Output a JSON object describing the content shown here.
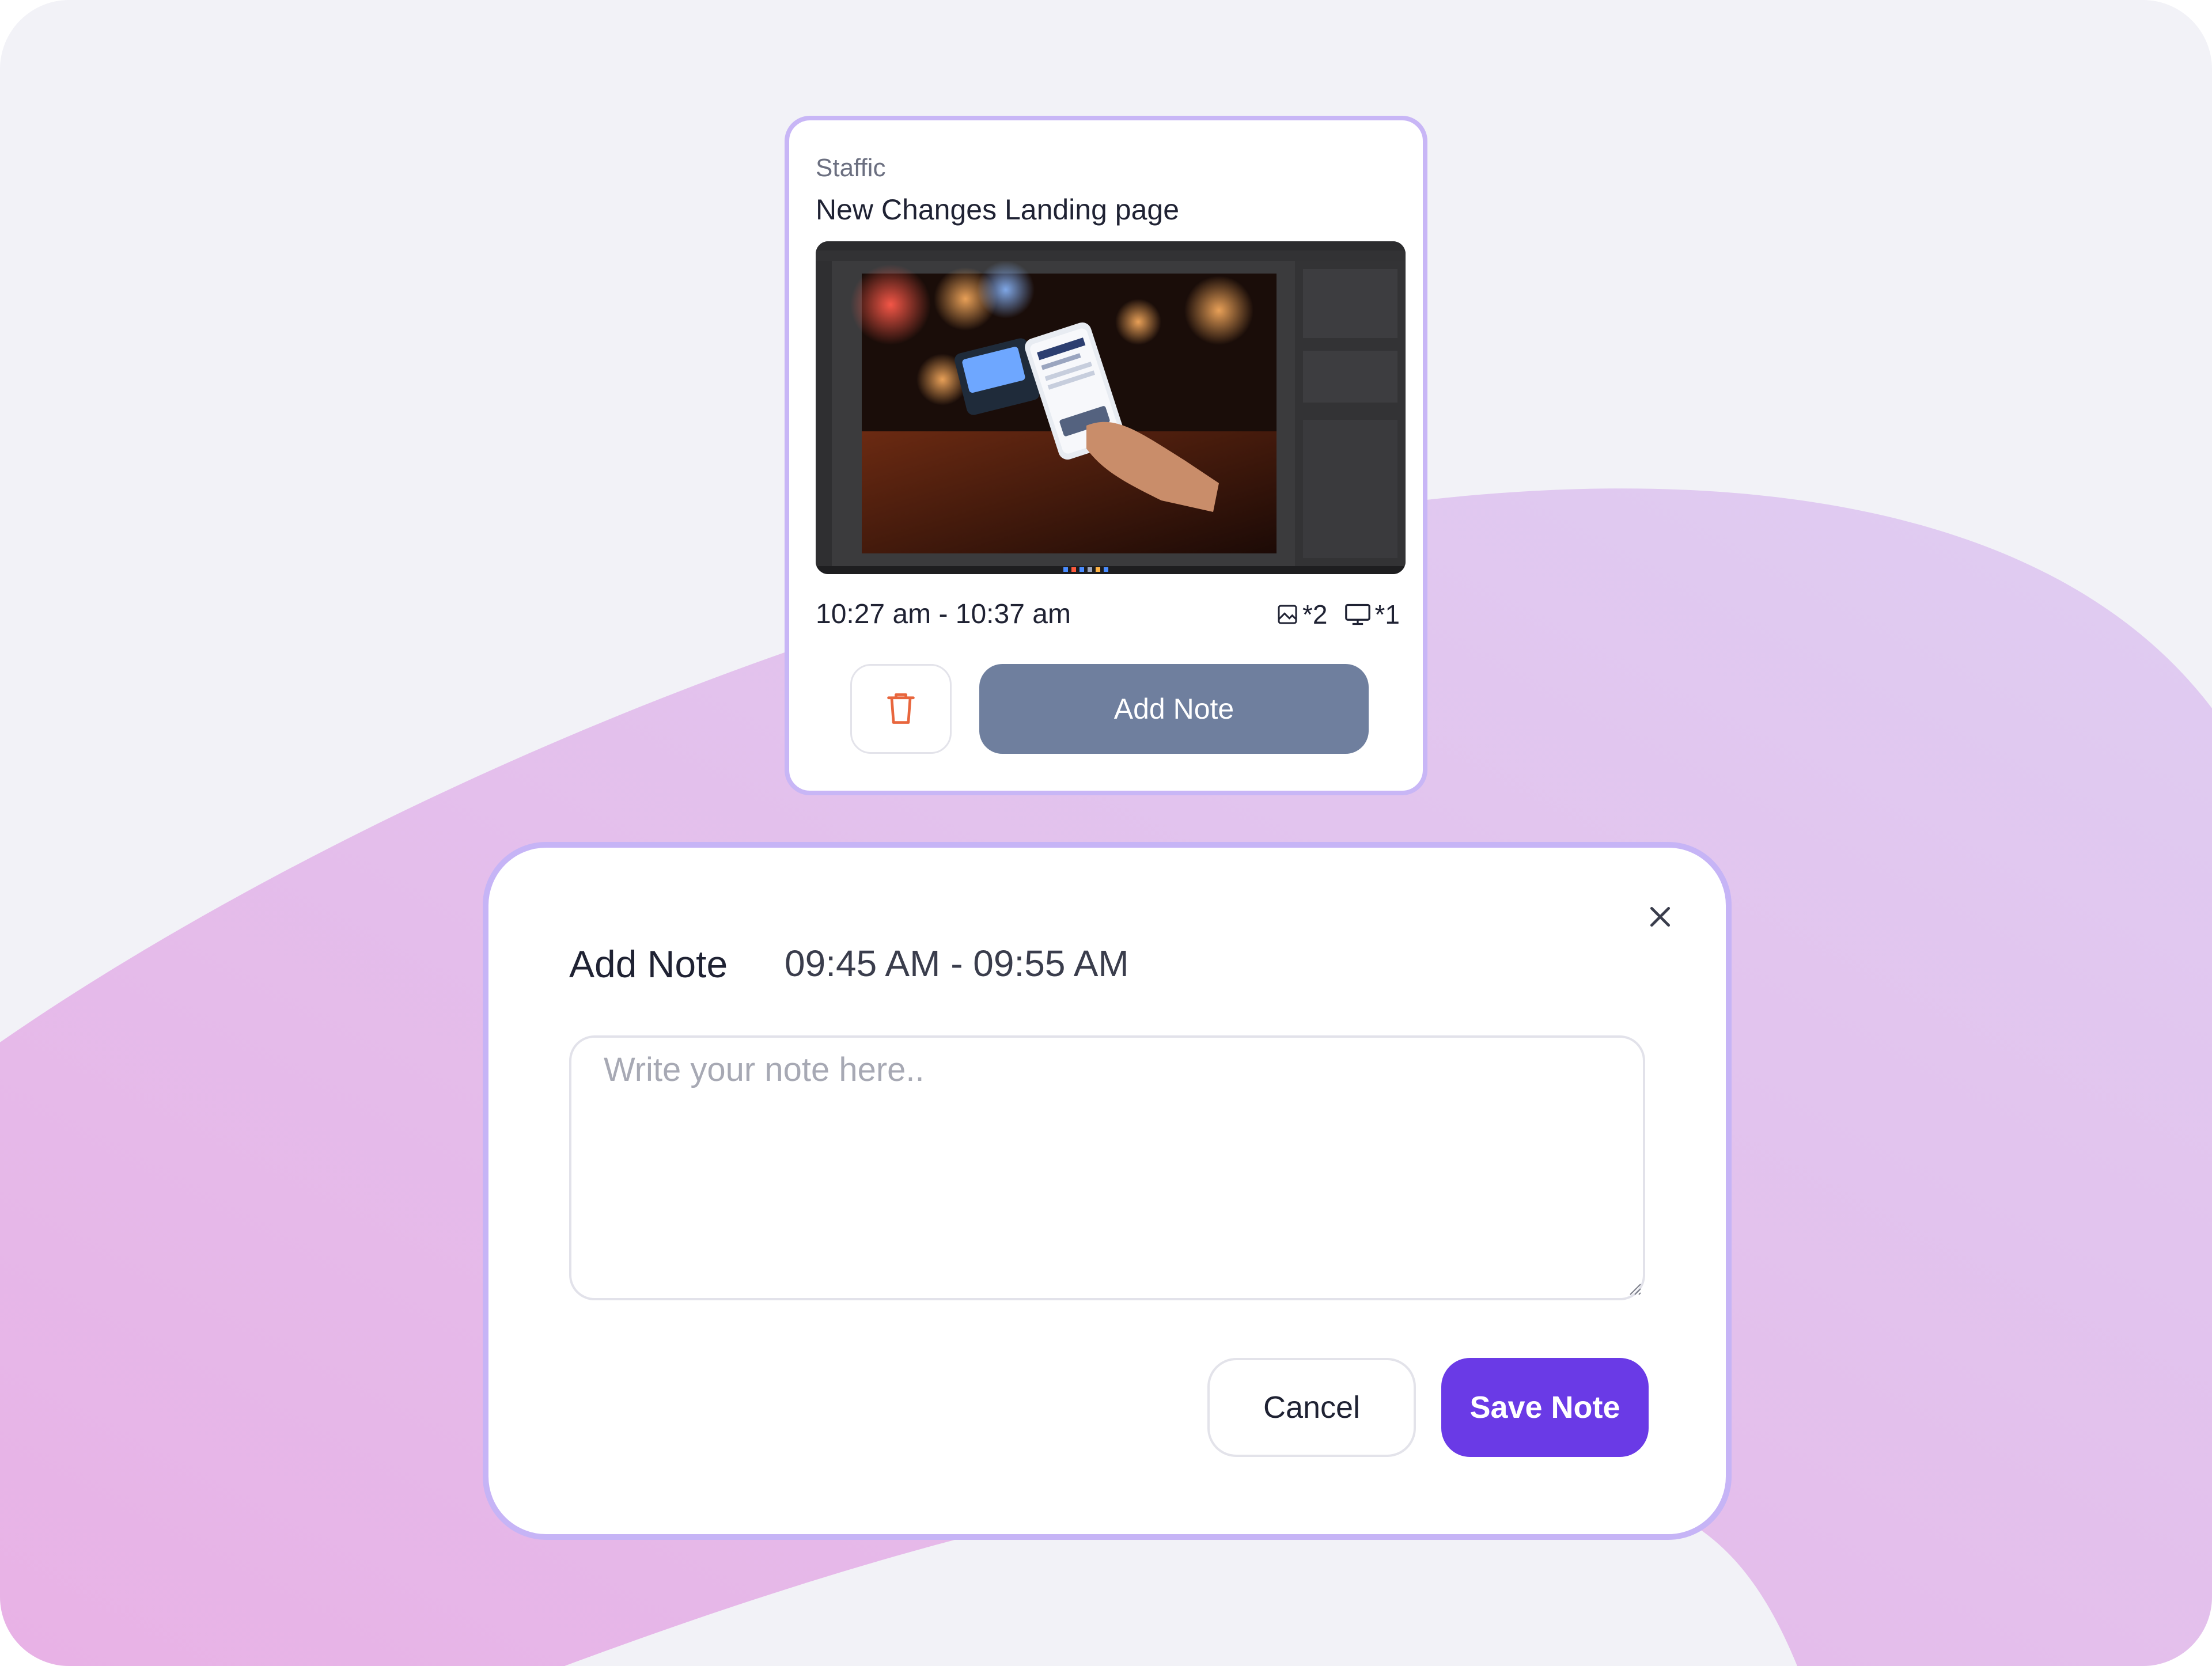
{
  "session_card": {
    "project": "Staffic",
    "title": "New Changes Landing page",
    "time_range": "10:27 am - 10:37 am",
    "image_count_label": "*2",
    "screen_count_label": "*1",
    "add_note_label": "Add Note",
    "delete_icon": "trash-icon",
    "image_icon": "image-icon",
    "screen_icon": "monitor-icon"
  },
  "modal": {
    "title": "Add Note",
    "time_range": "09:45 AM - 09:55 AM",
    "note_placeholder": "Write your note here..",
    "note_value": "",
    "cancel_label": "Cancel",
    "save_label": "Save Note",
    "close_icon": "close-icon"
  },
  "colors": {
    "accent": "#6a3ae6",
    "card_border": "#c8b6f6",
    "add_note_button": "#6f7f9e",
    "delete_icon": "#e8663d"
  }
}
